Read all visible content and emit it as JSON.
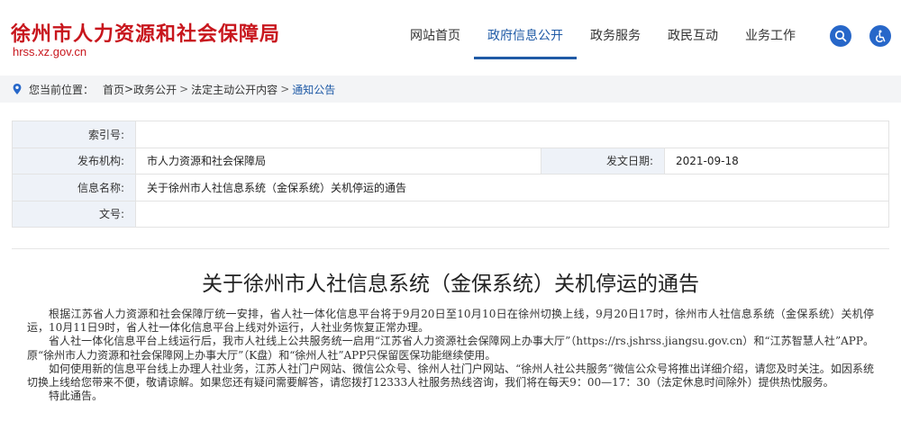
{
  "site": {
    "title": "徐州市人力资源和社会保障局",
    "domain": "hrss.xz.gov.cn"
  },
  "nav": {
    "items": [
      {
        "label": "网站首页",
        "active": false
      },
      {
        "label": "政府信息公开",
        "active": true
      },
      {
        "label": "政务服务",
        "active": false
      },
      {
        "label": "政民互动",
        "active": false
      },
      {
        "label": "业务工作",
        "active": false
      }
    ],
    "search_icon": "search-icon",
    "accessibility_icon": "accessibility-icon",
    "accent_color": "#1f5aa6",
    "brand_color": "#c8161d"
  },
  "breadcrumb": {
    "prefix": "您当前位置：",
    "items": [
      "首页",
      "政务公开",
      "法定主动公开内容",
      "通知公告"
    ],
    "separator": ">"
  },
  "info": {
    "index_label": "索引号:",
    "index_value": "",
    "publisher_label": "发布机构:",
    "publisher_value": "市人力资源和社会保障局",
    "date_label": "发文日期:",
    "date_value": "2021-09-18",
    "name_label": "信息名称:",
    "name_value": "关于徐州市人社信息系统（金保系统）关机停运的通告",
    "docno_label": "文号:",
    "docno_value": ""
  },
  "article": {
    "title": "关于徐州市人社信息系统（金保系统）关机停运的通告",
    "paragraphs": [
      "根据江苏省人力资源和社会保障厅统一安排，省人社一体化信息平台将于9月20日至10月10日在徐州切换上线，9月20日17时，徐州市人社信息系统（金保系统）关机停运，10月11日9时，省人社一体化信息平台上线对外运行，人社业务恢复正常办理。",
      "省人社一体化信息平台上线运行后，我市人社线上公共服务统一启用“江苏省人力资源社会保障网上办事大厅”（https://rs.jshrss.jiangsu.gov.cn）和“江苏智慧人社”APP。原“徐州市人力资源和社会保障网上办事大厅”（K盘）和“徐州人社”APP只保留医保功能继续使用。",
      "如何使用新的信息平台线上办理人社业务，江苏人社门户网站、微信公众号、徐州人社门户网站、“徐州人社公共服务”微信公众号将推出详细介绍，请您及时关注。如因系统切换上线给您带来不便，敬请谅解。如果您还有疑问需要解答，请您拨打12333人社服务热线咨询，我们将在每天9：00—17：30（法定休息时间除外）提供热忱服务。",
      "特此通告。"
    ]
  }
}
